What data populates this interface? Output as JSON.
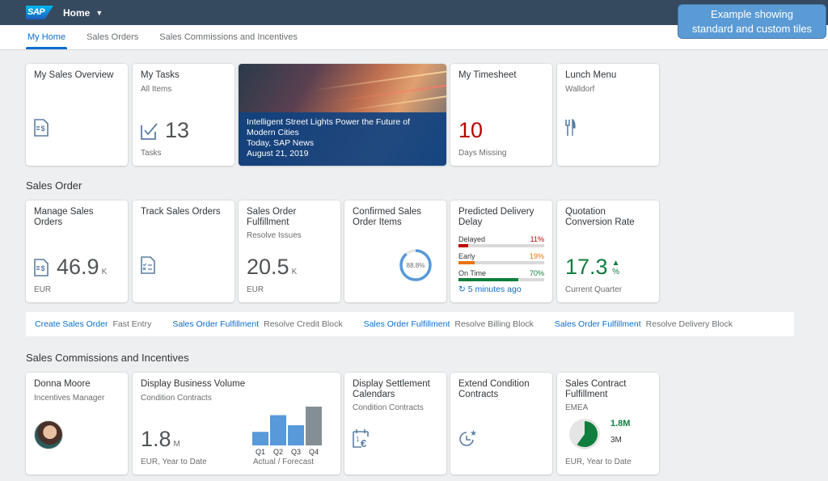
{
  "shell": {
    "logo": "SAP",
    "title": "Home"
  },
  "tabs": [
    {
      "label": "My Home",
      "active": true
    },
    {
      "label": "Sales Orders",
      "active": false
    },
    {
      "label": "Sales Commissions and Incentives",
      "active": false
    }
  ],
  "callout": {
    "line1": "Example showing",
    "line2": "standard and custom tiles"
  },
  "row1": {
    "sales_overview": {
      "title": "My Sales Overview",
      "icon": "sales-document-icon"
    },
    "tasks": {
      "title": "My Tasks",
      "subtitle": "All Items",
      "value": "13",
      "footer": "Tasks",
      "icon": "task-check-icon"
    },
    "news": {
      "headline": "Intelligent Street Lights Power the Future of Modern Cities",
      "source": "Today, SAP News",
      "date": "August 21, 2019"
    },
    "timesheet": {
      "title": "My Timesheet",
      "value": "10",
      "footer": "Days Missing",
      "value_color": "#bb0000"
    },
    "lunch": {
      "title": "Lunch Menu",
      "subtitle": "Walldorf",
      "icon": "fork-knife-icon"
    }
  },
  "sales_order": {
    "heading": "Sales Order",
    "manage": {
      "title": "Manage Sales Orders",
      "value": "46.9",
      "unit": "K",
      "footer": "EUR"
    },
    "track": {
      "title": "Track Sales Orders"
    },
    "fulfillment": {
      "title": "Sales Order Fulfillment",
      "subtitle": "Resolve Issues",
      "value": "20.5",
      "unit": "K",
      "footer": "EUR"
    },
    "confirmed": {
      "title": "Confirmed Sales Order Items",
      "percent_label": "88.8%",
      "percent": 88.8
    },
    "delivery": {
      "title": "Predicted Delivery Delay",
      "rows": [
        {
          "label": "Delayed",
          "value_label": "11%",
          "value": 11,
          "color": "#bb0000"
        },
        {
          "label": "Early",
          "value_label": "19%",
          "value": 19,
          "color": "#e9730c"
        },
        {
          "label": "On Time",
          "value_label": "70%",
          "value": 70,
          "color": "#107e3e"
        }
      ],
      "refresh": "5 minutes ago"
    },
    "quotation": {
      "title": "Quotation Conversion Rate",
      "value": "17.3",
      "unit": "%",
      "footer": "Current Quarter",
      "color": "#107e3e"
    }
  },
  "link_bar": [
    {
      "link": "Create Sales Order",
      "sub": "Fast Entry"
    },
    {
      "link": "Sales Order Fulfillment",
      "sub": "Resolve Credit Block"
    },
    {
      "link": "Sales Order Fulfillment",
      "sub": "Resolve Billing Block"
    },
    {
      "link": "Sales Order Fulfillment",
      "sub": "Resolve Delivery Block"
    }
  ],
  "commissions": {
    "heading": "Sales Commissions and Incentives",
    "person": {
      "name": "Donna Moore",
      "role": "Incentives Manager"
    },
    "business_volume": {
      "title": "Display Business Volume",
      "subtitle": "Condition Contracts",
      "value": "1.8",
      "unit": "M",
      "footer": "EUR, Year to Date",
      "chart_caption": "Actual / Forecast",
      "bars": [
        {
          "label": "Q1",
          "value": 0.35,
          "type": "actual"
        },
        {
          "label": "Q2",
          "value": 0.78,
          "type": "actual"
        },
        {
          "label": "Q3",
          "value": 0.52,
          "type": "actual"
        },
        {
          "label": "Q4",
          "value": 1.0,
          "type": "forecast"
        }
      ]
    },
    "settlement": {
      "title": "Display Settlement Calendars",
      "subtitle": "Condition Contracts"
    },
    "extend": {
      "title": "Extend Condition Contracts"
    },
    "contract": {
      "title": "Sales Contract Fulfillment",
      "subtitle": "EMEA",
      "actual": "1.8M",
      "target": "3M",
      "fraction": 0.6,
      "footer": "EUR, Year to Date"
    }
  }
}
